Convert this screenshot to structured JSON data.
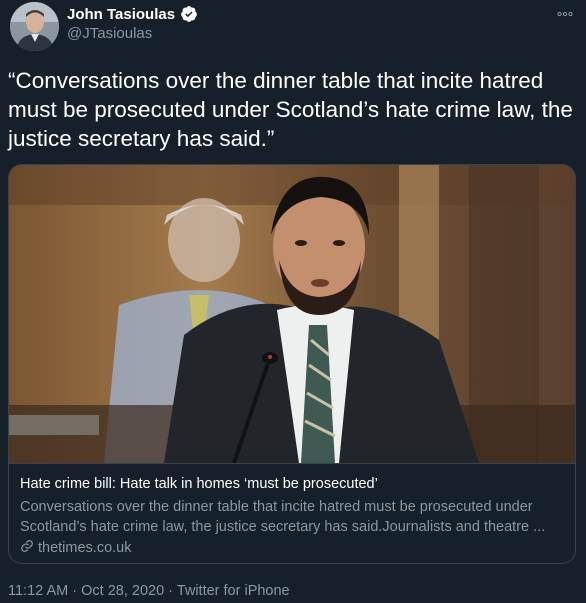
{
  "author": {
    "name": "John Tasioulas",
    "handle": "@JTasioulas"
  },
  "icons": {
    "verified": "verified-badge-icon",
    "more": "more-options-icon",
    "link": "link-icon"
  },
  "tweet_text": "“Conversations over the dinner table that incite hatred must be prosecuted under Scotland’s hate crime law, the justice secretary has said.”",
  "card": {
    "title": "Hate crime bill: Hate talk in homes ‘must be prosecuted’",
    "description": "Conversations over the dinner table that incite hatred must be prosecuted under Scotland’s hate crime law, the justice secretary has said.Journalists and theatre ...",
    "domain": "thetimes.co.uk"
  },
  "meta": {
    "time": "11:12 AM",
    "separator1": "·",
    "date": "Oct 28, 2020",
    "separator2": "·",
    "source": "Twitter for iPhone"
  },
  "colors": {
    "background": "#15202b",
    "secondary_text": "#8899a6",
    "border": "#38444d",
    "verified": "#ffffff"
  }
}
